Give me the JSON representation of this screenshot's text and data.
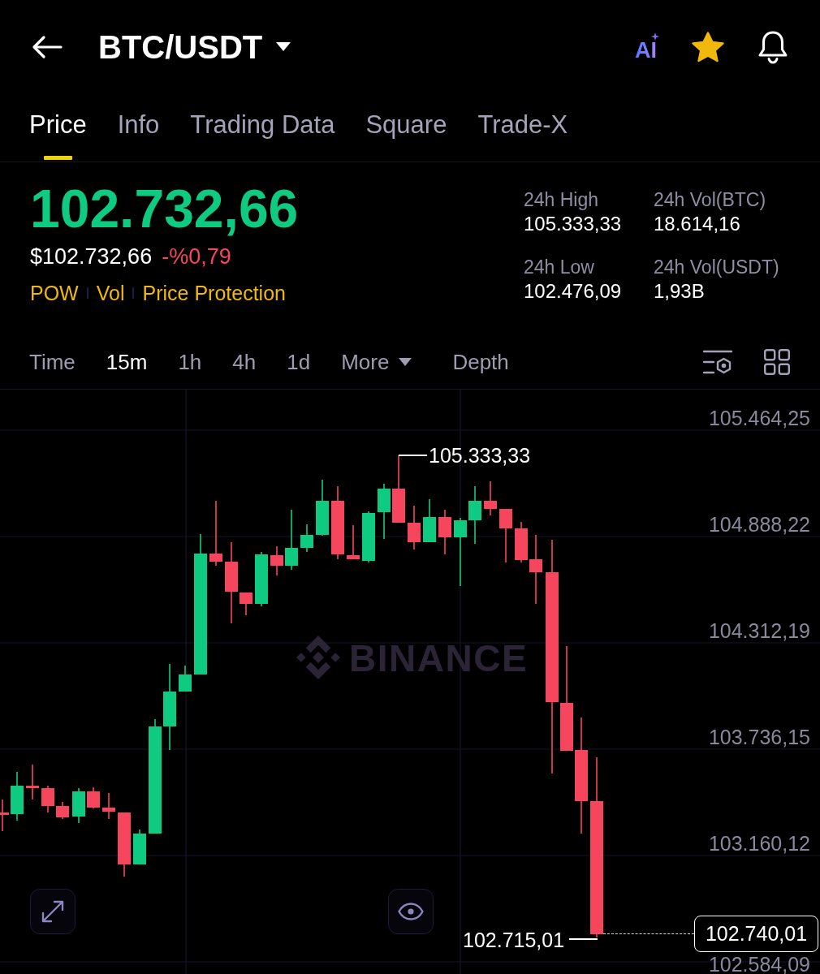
{
  "header": {
    "pair": "BTC/USDT",
    "ai_label": "AI",
    "favorite": true
  },
  "tabs": [
    {
      "label": "Price",
      "selected": true
    },
    {
      "label": "Info",
      "selected": false
    },
    {
      "label": "Trading Data",
      "selected": false
    },
    {
      "label": "Square",
      "selected": false
    },
    {
      "label": "Trade-X",
      "selected": false
    }
  ],
  "price": {
    "last": "102.732,66",
    "last_rising": true,
    "usd": "$102.732,66",
    "change": "-%0,79",
    "change_falling": true,
    "tags": [
      "POW",
      "Vol",
      "Price Protection"
    ]
  },
  "stats": [
    {
      "label": "24h High",
      "value": "105.333,33"
    },
    {
      "label": "24h Vol(BTC)",
      "value": "18.614,16"
    },
    {
      "label": "24h Low",
      "value": "102.476,09"
    },
    {
      "label": "24h Vol(USDT)",
      "value": "1,93B"
    }
  ],
  "intervals": [
    {
      "label": "Time",
      "kind": "option",
      "selected": false
    },
    {
      "label": "15m",
      "kind": "option",
      "selected": true
    },
    {
      "label": "1h",
      "kind": "option",
      "selected": false
    },
    {
      "label": "4h",
      "kind": "option",
      "selected": false
    },
    {
      "label": "1d",
      "kind": "option",
      "selected": false
    },
    {
      "label": "More",
      "kind": "dropdown",
      "selected": false
    },
    {
      "label": "Depth",
      "kind": "option",
      "selected": false
    }
  ],
  "chart": {
    "price_labels": [
      "105.464,25",
      "104.888,22",
      "104.312,19",
      "103.736,15",
      "103.160,12",
      "102.584,09"
    ],
    "high_marker": "105.333,33",
    "low_marker": "102.715,01",
    "last_price": "102.740,01",
    "watermark": "BINANCE"
  }
}
